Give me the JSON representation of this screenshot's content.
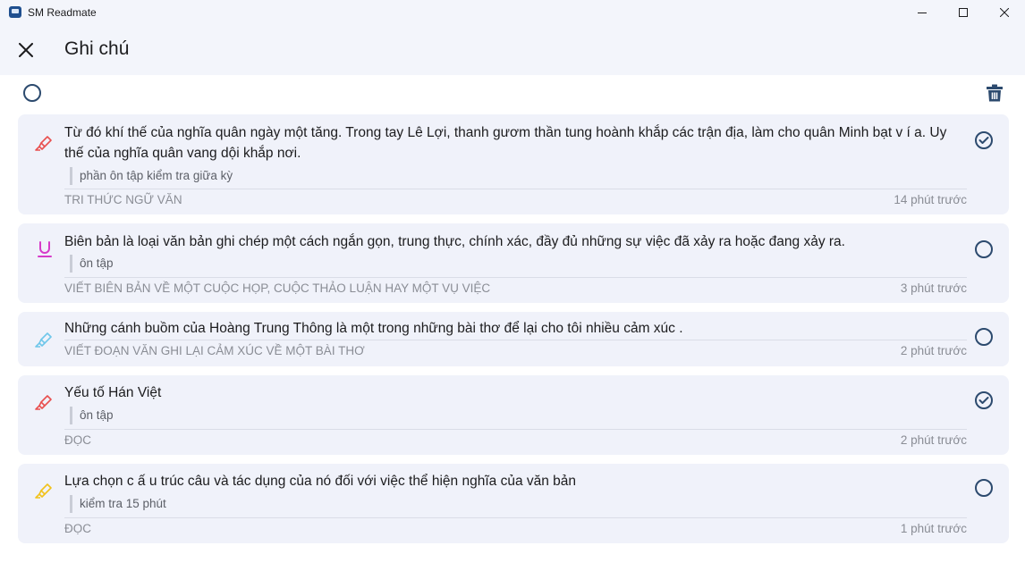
{
  "window": {
    "title": "SM Readmate"
  },
  "header": {
    "title": "Ghi chú"
  },
  "colors": {
    "accent": "#2c4a6e",
    "header_bg": "#f3f5fb",
    "card_bg": "#f0f2fa"
  },
  "notes": [
    {
      "text": "Từ đó khí thế của nghĩa quân ngày một tăng. Trong tay Lê Lợi, thanh gươm thần tung hoành khắp các trận địa, làm cho quân Minh bạt v í a. Uy thế của nghĩa quân vang dội khắp nơi.",
      "comment": "phần ôn tập kiểm tra giữa kỳ",
      "source": "TRI THỨC NGỮ VĂN",
      "time": "14 phút trước",
      "icon": "highlighter-icon",
      "icon_color": "#e8504f",
      "checked": true
    },
    {
      "text": "Biên bản là loại văn bản ghi chép một cách ngắn gọn, trung thực, chính xác, đầy đủ những sự việc đã xảy ra hoặc đang xảy ra.",
      "comment": "ôn tập",
      "source": "VIẾT BIÊN BẢN VỀ MỘT CUỘC HỌP, CUỘC THẢO LUẬN HAY MỘT VỤ VIỆC",
      "time": "3 phút trước",
      "icon": "underline-icon",
      "icon_color": "#d63bc9",
      "checked": false
    },
    {
      "text": "Những cánh buồm của Hoàng Trung Thông là một trong những bài thơ để lại cho tôi nhiều cảm xúc .",
      "comment": "",
      "source": "VIẾT ĐOẠN VĂN GHI LẠI CẢM XÚC VỀ MỘT BÀI THƠ",
      "time": "2 phút trước",
      "icon": "highlighter-icon",
      "icon_color": "#6fc7ea",
      "checked": false
    },
    {
      "text": "Yếu tố Hán Việt",
      "comment": "ôn tập",
      "source": "ĐỌC",
      "time": "2 phút trước",
      "icon": "highlighter-icon",
      "icon_color": "#e8504f",
      "checked": true
    },
    {
      "text": "Lựa chọn c ấ u trúc câu và tác dụng của nó đối với việc thể hiện nghĩa của văn bản",
      "comment": "kiểm tra 15 phút",
      "source": "ĐỌC",
      "time": "1 phút trước",
      "icon": "highlighter-icon",
      "icon_color": "#f1c21b",
      "checked": false
    }
  ]
}
